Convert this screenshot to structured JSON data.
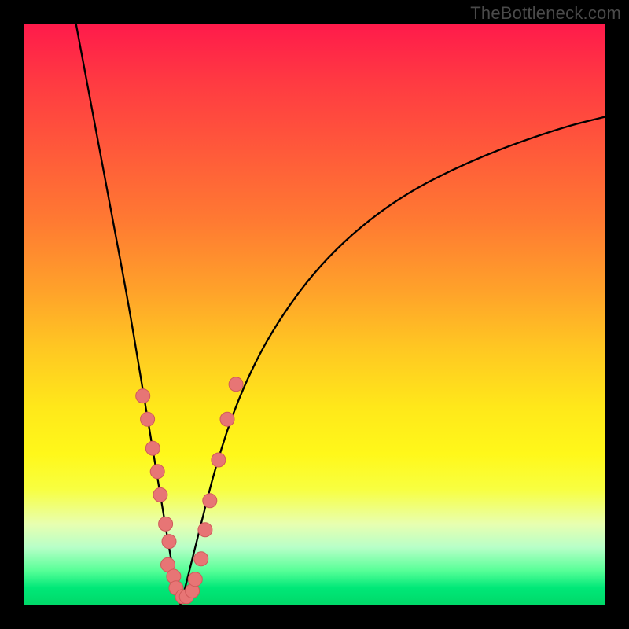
{
  "watermark": "TheBottleneck.com",
  "chart_data": {
    "type": "line",
    "title": "",
    "xlabel": "",
    "ylabel": "",
    "xlim": [
      0,
      100
    ],
    "ylim": [
      0,
      100
    ],
    "grid": false,
    "legend": false,
    "description": "Two black curves descending from the top edge, converging to a sharp V near x≈27, over a red→green vertical gradient indicating bottleneck severity. Salmon dots cluster near the V-bottom.",
    "series": [
      {
        "name": "left-arm",
        "x": [
          9,
          12,
          15,
          18,
          20,
          22,
          24,
          25,
          26,
          27
        ],
        "y": [
          100,
          84,
          68,
          52,
          40,
          28,
          16,
          10,
          4,
          0
        ]
      },
      {
        "name": "right-arm",
        "x": [
          27,
          28,
          30,
          33,
          37,
          43,
          52,
          64,
          78,
          92,
          100
        ],
        "y": [
          0,
          4,
          12,
          24,
          36,
          48,
          60,
          70,
          77,
          82,
          84
        ]
      }
    ],
    "points": {
      "name": "markers",
      "xy": [
        [
          20.5,
          36
        ],
        [
          21.3,
          32
        ],
        [
          22.2,
          27
        ],
        [
          23.0,
          23
        ],
        [
          23.5,
          19
        ],
        [
          24.4,
          14
        ],
        [
          25.0,
          11
        ],
        [
          24.8,
          7
        ],
        [
          25.8,
          5
        ],
        [
          26.2,
          3
        ],
        [
          27.3,
          1.5
        ],
        [
          28.0,
          1.5
        ],
        [
          29.0,
          2.5
        ],
        [
          29.5,
          4.5
        ],
        [
          30.5,
          8
        ],
        [
          31.2,
          13
        ],
        [
          32.0,
          18
        ],
        [
          33.5,
          25
        ],
        [
          35.0,
          32
        ],
        [
          36.5,
          38
        ]
      ]
    },
    "gradient_stops": [
      {
        "pos": 0,
        "color": "#ff1a4b"
      },
      {
        "pos": 50,
        "color": "#ffd020"
      },
      {
        "pos": 80,
        "color": "#f8ff60"
      },
      {
        "pos": 100,
        "color": "#00d868"
      }
    ]
  }
}
